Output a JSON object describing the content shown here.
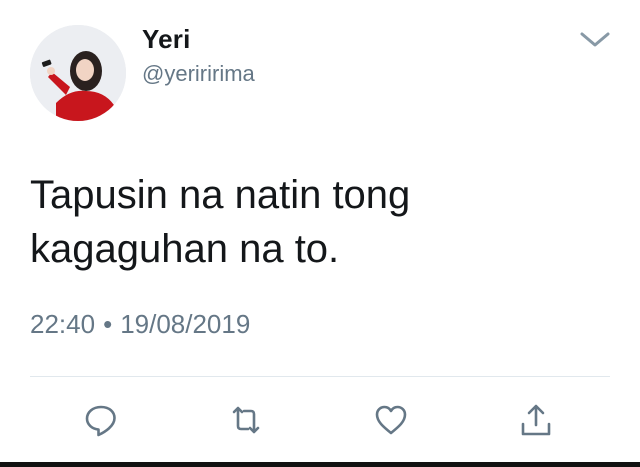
{
  "user": {
    "display_name": "Yeri",
    "handle": "@yeriririma",
    "avatar_icon": "avatar-photo"
  },
  "tweet": {
    "text_line1": "Tapusin na natin tong",
    "text_line2": "kagaguhan na to.",
    "time": "22:40",
    "separator": "•",
    "date": "19/08/2019"
  },
  "actions": {
    "reply_icon": "reply-icon",
    "retweet_icon": "retweet-icon",
    "like_icon": "heart-icon",
    "share_icon": "share-icon"
  },
  "colors": {
    "text_primary": "#14171a",
    "text_secondary": "#657786",
    "divider": "#e1e8ed",
    "icon": "#657786"
  }
}
